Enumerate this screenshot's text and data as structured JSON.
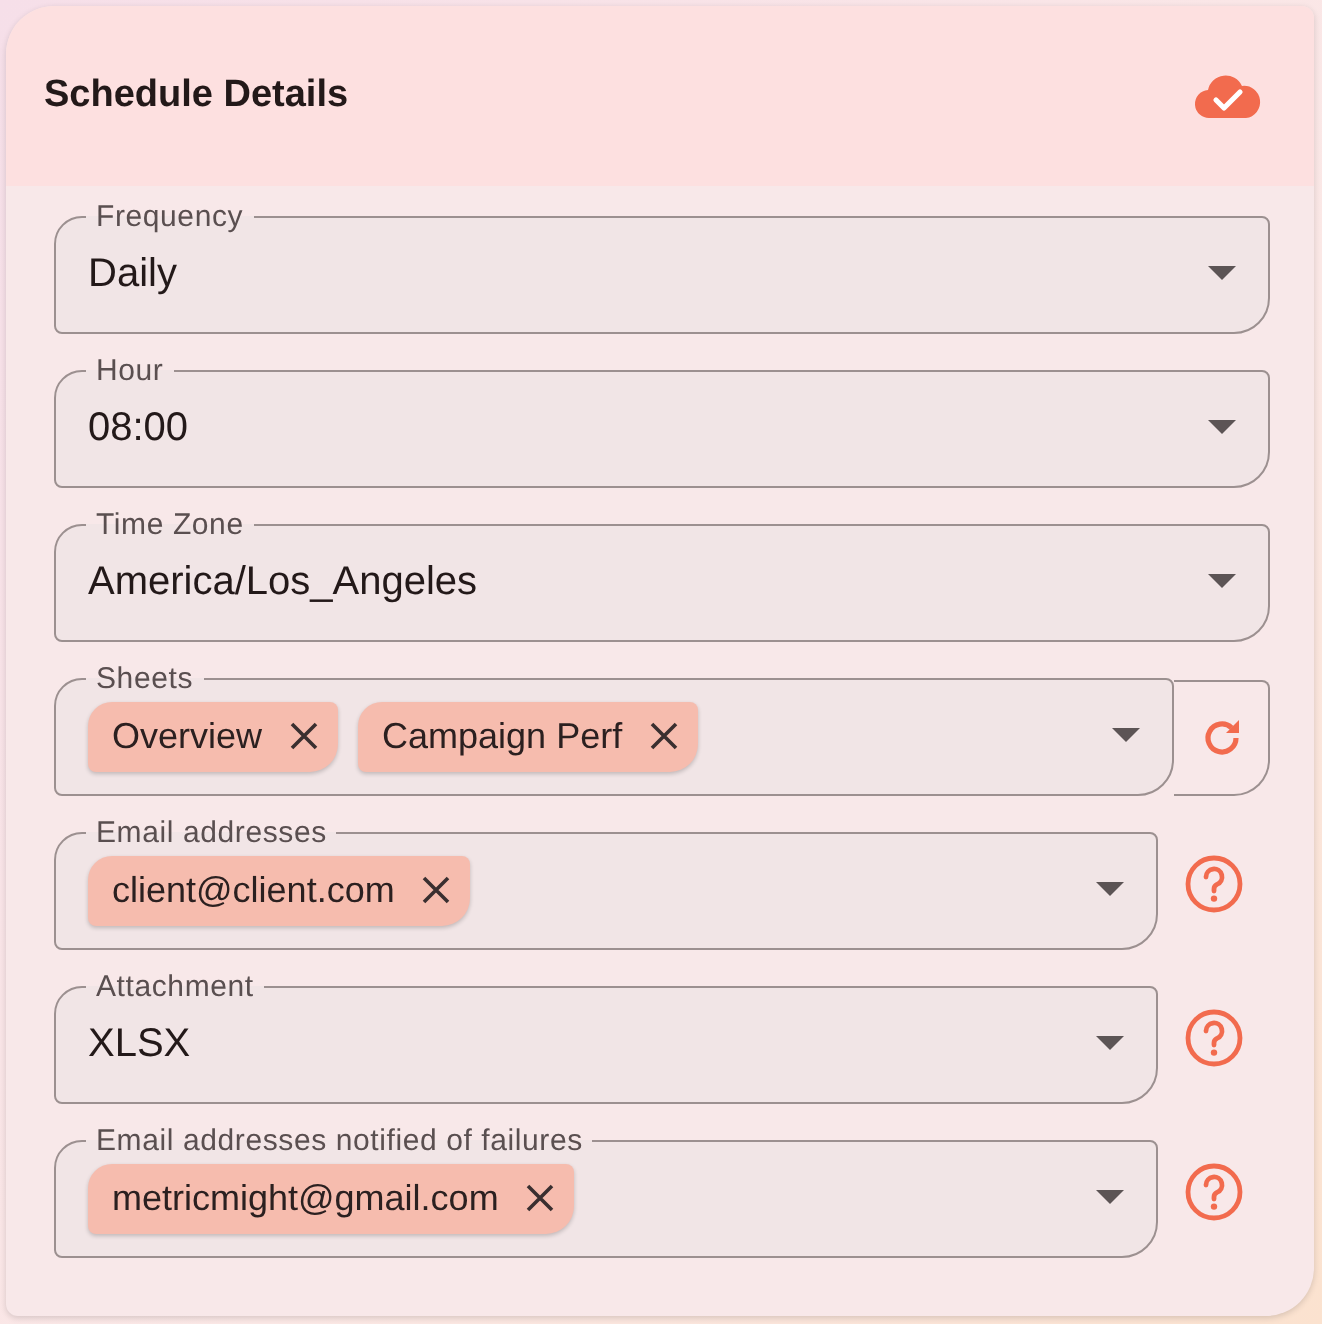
{
  "card": {
    "title": "Schedule Details",
    "saved": true
  },
  "fields": [
    {
      "kind": "select",
      "label": "Frequency",
      "value": "Daily"
    },
    {
      "kind": "select",
      "label": "Hour",
      "value": "08:00"
    },
    {
      "kind": "select",
      "label": "Time Zone",
      "value": "America/Los_Angeles"
    },
    {
      "kind": "chips",
      "label": "Sheets",
      "chips": [
        "Overview",
        "Campaign Perf"
      ],
      "action": {
        "kind": "refresh"
      }
    },
    {
      "kind": "chips",
      "label": "Email addresses",
      "chips": [
        "client@client.com"
      ],
      "action": {
        "kind": "help"
      }
    },
    {
      "kind": "select",
      "label": "Attachment",
      "value": "XLSX",
      "action": {
        "kind": "help"
      }
    },
    {
      "kind": "chips",
      "label": "Email addresses notified of failures",
      "chips": [
        "metricmight@gmail.com"
      ],
      "action": {
        "kind": "help"
      }
    }
  ]
}
